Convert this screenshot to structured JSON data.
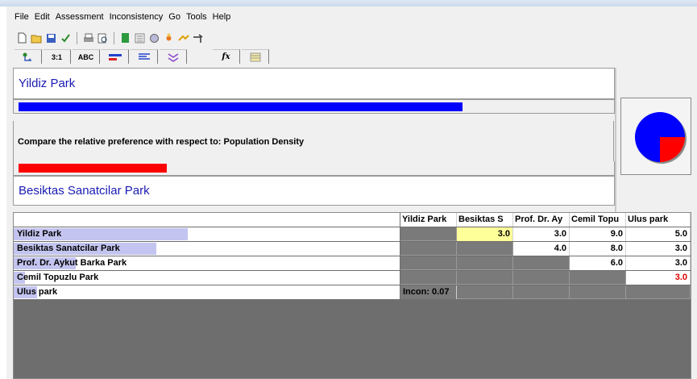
{
  "menu": [
    "File",
    "Edit",
    "Assessment",
    "Inconsistency",
    "Go",
    "Tools",
    "Help"
  ],
  "toolbar_icons": [
    "new-icon",
    "open-icon",
    "save-icon",
    "check-icon",
    "print-icon",
    "preview-icon",
    "calc-icon",
    "sheet-icon",
    "settings-icon",
    "flower-icon",
    "swap-icon",
    "arrow-icon"
  ],
  "tabs": [
    {
      "name": "tree-tab",
      "label": "☉"
    },
    {
      "name": "ratio-tab",
      "label": "3:1"
    },
    {
      "name": "verbal-tab",
      "label": "ABC"
    },
    {
      "name": "graphic-tab",
      "label": "≡"
    },
    {
      "name": "questionnaire-tab",
      "label": "≡"
    },
    {
      "name": "sensitivity-tab",
      "label": "≈"
    },
    {
      "name": "formula-tab",
      "label": "fx"
    },
    {
      "name": "matrix-tab",
      "label": "▤"
    }
  ],
  "comparison": {
    "left_name": "Yildiz Park",
    "right_name": "Besiktas Sanatcilar Park",
    "prompt": "Compare the relative preference with respect to: Population Density",
    "left_bar_fraction": 0.75,
    "right_bar_fraction": 0.25,
    "left_color": "#0000ff",
    "right_color": "#ff0000"
  },
  "matrix": {
    "columns": [
      "Yildiz Park",
      "Besiktas S",
      "Prof. Dr. Ay",
      "Cemil Topu",
      "Ulus park"
    ],
    "rows": [
      {
        "label": "Yildiz Park",
        "highlight": 0.45,
        "cells": [
          "",
          "3.0",
          "3.0",
          "9.0",
          "5.0"
        ]
      },
      {
        "label": "Besiktas Sanatcilar Park",
        "highlight": 0.37,
        "cells": [
          "",
          "",
          "4.0",
          "8.0",
          "3.0"
        ]
      },
      {
        "label": "Prof. Dr. Aykut Barka Park",
        "highlight": 0.16,
        "cells": [
          "",
          "",
          "",
          "6.0",
          "3.0"
        ]
      },
      {
        "label": "Cemil Topuzlu Park",
        "highlight": 0.03,
        "cells": [
          "",
          "",
          "",
          "",
          "3.0"
        ]
      },
      {
        "label": "Ulus park",
        "highlight": 0.06,
        "cells": [
          "Incon: 0.07",
          "",
          "",
          "",
          ""
        ]
      }
    ]
  }
}
